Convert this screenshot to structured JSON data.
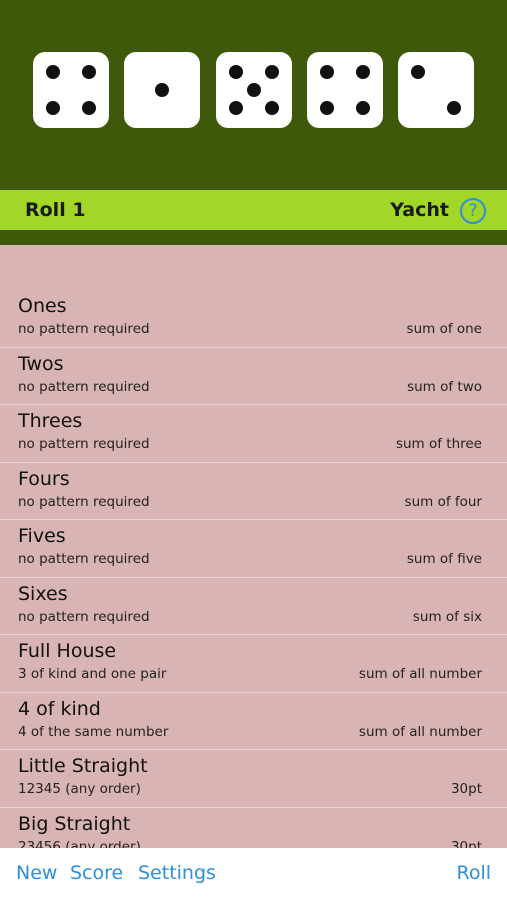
{
  "dice": [
    4,
    1,
    5,
    4,
    2
  ],
  "status": {
    "roll_label": "Roll 1",
    "game_label": "Yacht",
    "help_glyph": "?"
  },
  "categories": [
    {
      "name": "Ones",
      "desc": "no pattern required",
      "score": "sum of one"
    },
    {
      "name": "Twos",
      "desc": "no pattern required",
      "score": "sum of two"
    },
    {
      "name": "Threes",
      "desc": "no pattern required",
      "score": "sum of three"
    },
    {
      "name": "Fours",
      "desc": "no pattern required",
      "score": "sum of four"
    },
    {
      "name": "Fives",
      "desc": "no pattern required",
      "score": "sum of five"
    },
    {
      "name": "Sixes",
      "desc": "no pattern required",
      "score": "sum of six"
    },
    {
      "name": "Full House",
      "desc": "3 of kind and one pair",
      "score": "sum of all number"
    },
    {
      "name": "4 of kind",
      "desc": "4 of the same number",
      "score": "sum of all number"
    },
    {
      "name": "Little Straight",
      "desc": "12345 (any order)",
      "score": "30pt"
    },
    {
      "name": "Big Straight",
      "desc": "23456 (any order)",
      "score": "30pt"
    }
  ],
  "toolbar": {
    "new_label": "New",
    "score_label": "Score",
    "settings_label": "Settings",
    "roll_label": "Roll"
  },
  "colors": {
    "dice_bg": "#3e590a",
    "status_bar": "#a2d629",
    "list_bg": "#d9b4b4",
    "accent": "#2d8fd9"
  }
}
